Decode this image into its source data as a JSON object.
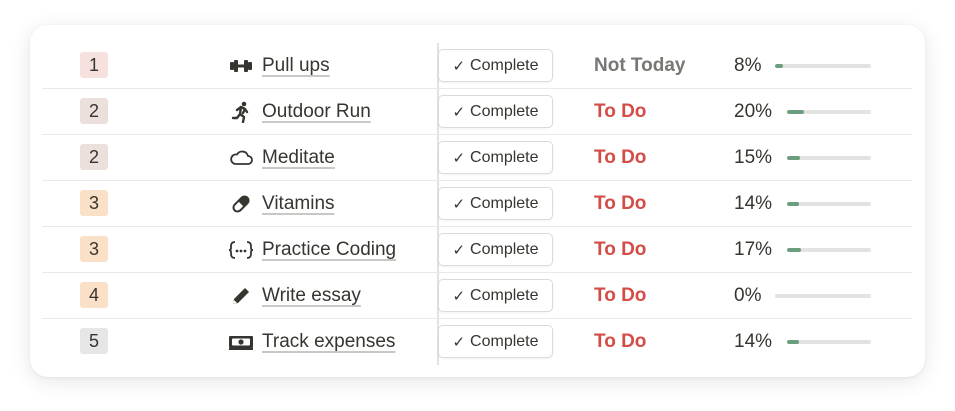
{
  "colors": {
    "status_not_today": "#787774",
    "status_todo": "#d44c47",
    "progress_fill": "#6b9e7e",
    "priority_1": "#f7e1de",
    "priority_2": "#ece0dd",
    "priority_3": "#fbe0c8",
    "priority_4": "#fbe0c8",
    "priority_5": "#e6e6e6"
  },
  "complete_label": "Complete",
  "complete_check": "✓",
  "rows": [
    {
      "priority": "1",
      "icon": "dumbbell-icon",
      "task": "Pull ups",
      "status": "Not Today",
      "status_kind": "not_today",
      "percent_label": "8%",
      "progress": 0.08
    },
    {
      "priority": "2",
      "icon": "runner-icon",
      "task": "Outdoor Run",
      "status": "To Do",
      "status_kind": "todo",
      "percent_label": "20%",
      "progress": 0.2
    },
    {
      "priority": "2",
      "icon": "cloud-icon",
      "task": "Meditate",
      "status": "To Do",
      "status_kind": "todo",
      "percent_label": "15%",
      "progress": 0.15
    },
    {
      "priority": "3",
      "icon": "pill-icon",
      "task": "Vitamins",
      "status": "To Do",
      "status_kind": "todo",
      "percent_label": "14%",
      "progress": 0.14
    },
    {
      "priority": "3",
      "icon": "code-icon",
      "task": "Practice Coding",
      "status": "To Do",
      "status_kind": "todo",
      "percent_label": "17%",
      "progress": 0.17
    },
    {
      "priority": "4",
      "icon": "pencil-icon",
      "task": "Write essay",
      "status": "To Do",
      "status_kind": "todo",
      "percent_label": "0%",
      "progress": 0.0
    },
    {
      "priority": "5",
      "icon": "money-icon",
      "task": "Track expenses",
      "status": "To Do",
      "status_kind": "todo",
      "percent_label": "14%",
      "progress": 0.14
    }
  ]
}
